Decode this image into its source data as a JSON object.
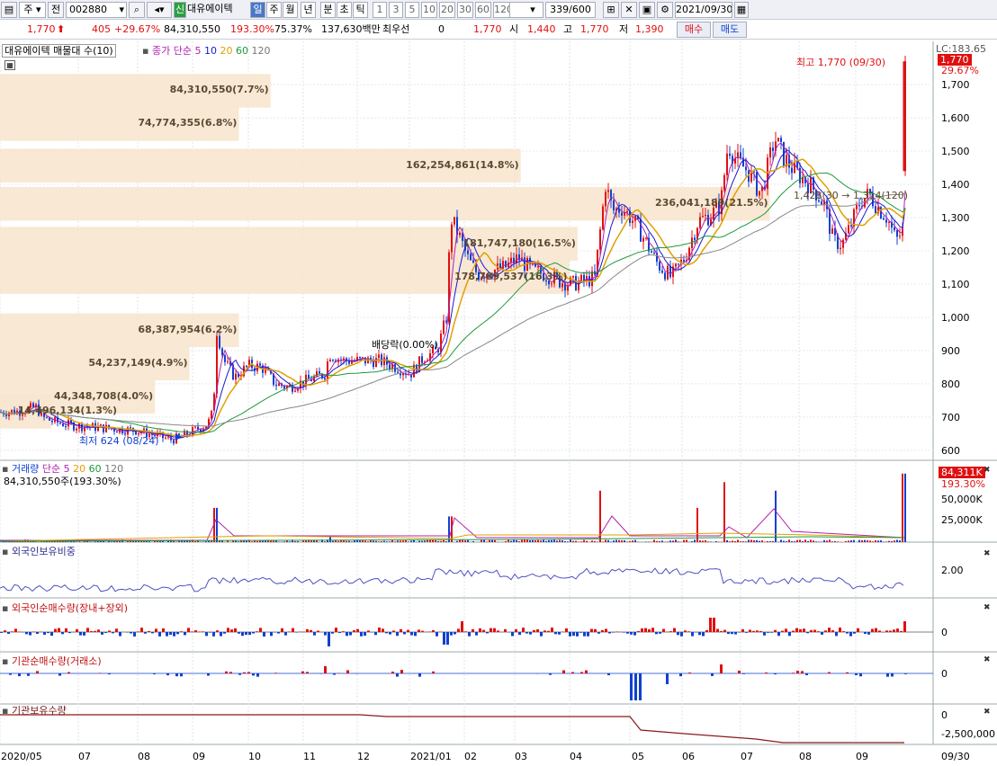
{
  "toolbar": {
    "type_select": "주",
    "prev": "전",
    "code": "002880",
    "company_tag": "신",
    "company": "대유에이텍",
    "periods": [
      "일",
      "주",
      "월",
      "년",
      "분",
      "초",
      "틱"
    ],
    "numbers": [
      "1",
      "3",
      "5",
      "10",
      "20",
      "30",
      "60",
      "120"
    ],
    "count": "339/600",
    "date": "2021/09/30"
  },
  "quote": {
    "price": "1,770",
    "change": "405",
    "change_pct": "+29.67%",
    "volume": "84,310,550",
    "vol_ratio": "193.30%",
    "turnover_pct": "75.37%",
    "amount": "137,630백만",
    "priority_label": "최우선",
    "priority_val": "0",
    "ask": "1,770",
    "open_label": "시",
    "open": "1,440",
    "high_label": "고",
    "high": "1,770",
    "low_label": "저",
    "low": "1,390",
    "buy": "매수",
    "sell": "매도"
  },
  "main_panel": {
    "title": "대유에이텍 매물대 수(10)",
    "ma_label": "종가 단순",
    "ma_periods": [
      "5",
      "10",
      "20",
      "60",
      "120"
    ],
    "price_ticks": [
      "1,700",
      "1,600",
      "1,500",
      "1,400",
      "1,300",
      "1,200",
      "1,100",
      "1,000",
      "900",
      "800",
      "700",
      "600"
    ],
    "lc": "LC:183.65",
    "cur_price": "1,770",
    "cur_pct": "29.67%",
    "high_note": "최고 1,770 (09/30)",
    "low_note": "최저 624 (08/24)",
    "dividend_note": "배당락(0.00%)",
    "profile": [
      {
        "label": "14,496,134(1.3%)",
        "price": 715,
        "pct": 5.5
      },
      {
        "label": "44,348,708(4.0%)",
        "price": 760,
        "pct": 16.6
      },
      {
        "label": "54,237,149(4.9%)",
        "price": 860,
        "pct": 20.3
      },
      {
        "label": "68,387,954(6.2%)",
        "price": 960,
        "pct": 25.6
      },
      {
        "label": "178,789,537(16.3%)",
        "price": 1120,
        "pct": 61.0
      },
      {
        "label": "181,747,180(16.5%)",
        "price": 1220,
        "pct": 61.9
      },
      {
        "label": "236,041,189(21.5%)",
        "price": 1340,
        "pct": 82.5
      },
      {
        "label": "162,254,861(14.8%)",
        "price": 1455,
        "pct": 55.8
      },
      {
        "label": "74,774,355(6.8%)",
        "price": 1580,
        "pct": 25.6
      },
      {
        "label": "84,310,550(7.7%)",
        "price": 1680,
        "pct": 29.0
      }
    ],
    "legend_tail": "1,428(30 → 1,314(120)"
  },
  "volume_panel": {
    "title": "거래량",
    "ma_label": "단순",
    "ma_periods": [
      "5",
      "20",
      "60",
      "120"
    ],
    "sub": "84,310,550주(193.30%)",
    "ticks": [
      "50,000K",
      "25,000K"
    ],
    "cur": "84,311K",
    "cur_pct": "193.30%"
  },
  "foreign_ratio_panel": {
    "title": "외국인보유비중",
    "ticks": [
      "2.00"
    ]
  },
  "foreign_net_panel": {
    "title": "외국인순매수량(장내+장외)",
    "ticks": [
      "0"
    ]
  },
  "inst_net_panel": {
    "title": "기관순매수량(거래소)",
    "ticks": [
      "0"
    ]
  },
  "inst_hold_panel": {
    "title": "기관보유수량",
    "ticks": [
      "0",
      "-2,500,000"
    ]
  },
  "x_axis": [
    "2020/05",
    "07",
    "08",
    "09",
    "10",
    "11",
    "12",
    "2021/01",
    "02",
    "03",
    "04",
    "05",
    "06",
    "07",
    "08",
    "09",
    "09/30"
  ],
  "chart_data": {
    "type": "candlestick",
    "ylim": [
      570,
      1830
    ],
    "ticker": "002880",
    "name": "대유에이텍",
    "last_close": 1770,
    "high": 1770,
    "low": 624
  }
}
